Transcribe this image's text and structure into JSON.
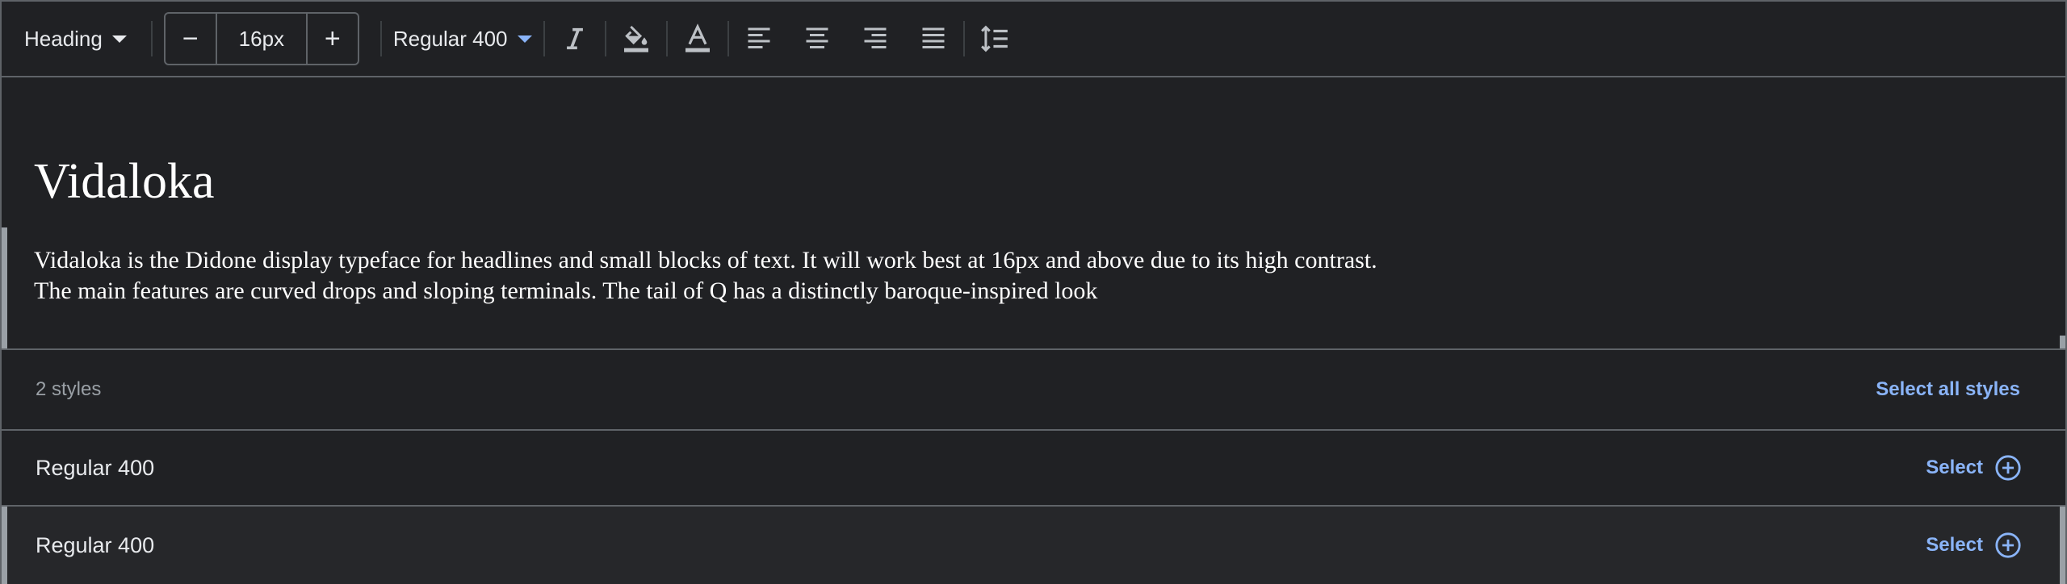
{
  "toolbar": {
    "style_dropdown": "Heading",
    "font_size": "16px",
    "decrease_label": "−",
    "increase_label": "+",
    "weight_dropdown": "Regular 400"
  },
  "preview": {
    "heading": "Vidaloka",
    "body_line1": "Vidaloka is the Didone display typeface for headlines and small blocks of text. It will work best at 16px and above due to its high contrast.",
    "body_line2": "The main features are curved drops and sloping terminals. The tail of Q has a distinctly baroque-inspired look"
  },
  "styles": {
    "count_label": "2 styles",
    "select_all_label": "Select all styles",
    "items": [
      {
        "name": "Regular 400",
        "action": "Select"
      },
      {
        "name": "Regular 400",
        "action": "Select"
      }
    ]
  },
  "colors": {
    "background": "#202124",
    "accent": "#8ab4f8",
    "border": "#5f6368"
  }
}
